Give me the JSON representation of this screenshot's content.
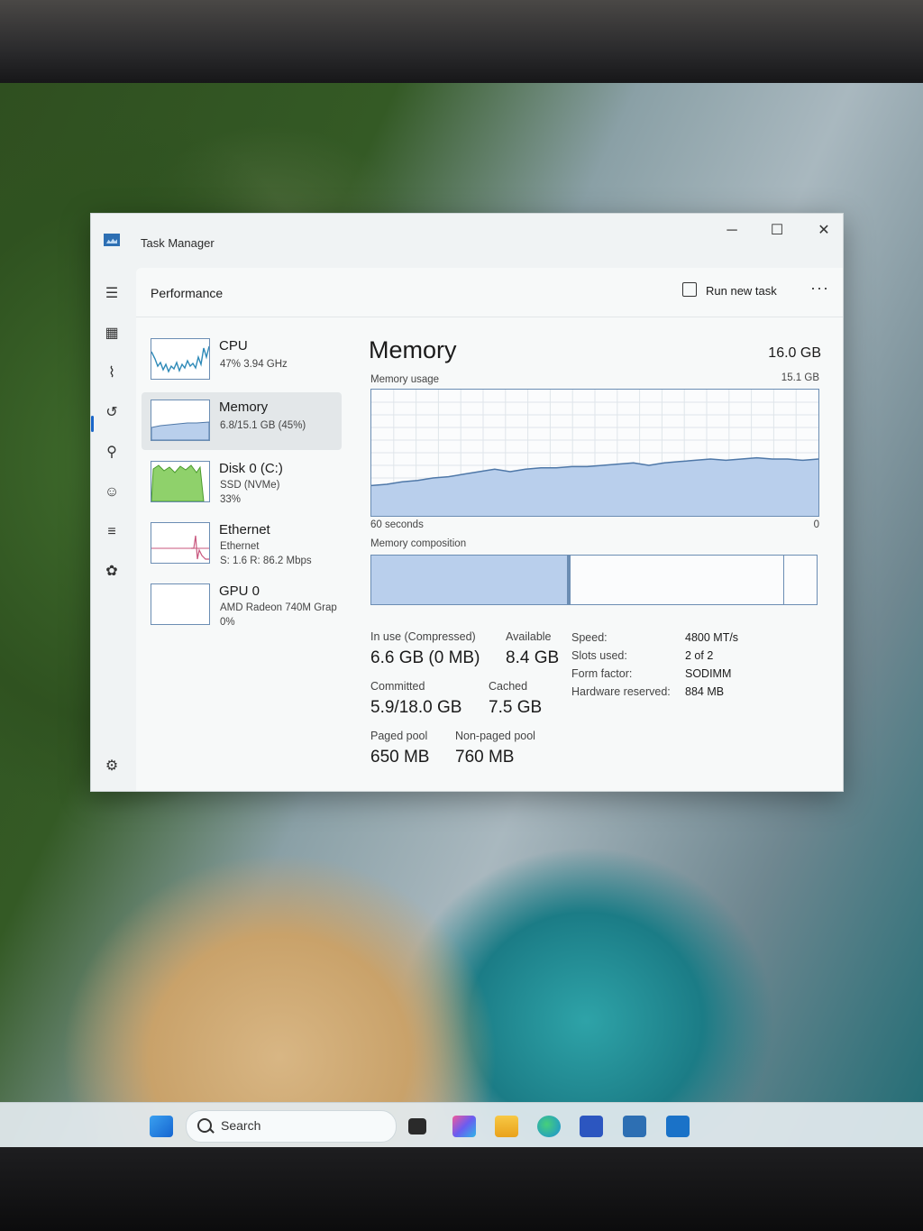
{
  "window": {
    "title": "Task Manager",
    "controls": {
      "minimize": "─",
      "maximize": "☐",
      "close": "✕"
    }
  },
  "nav": {
    "icons": [
      "hamburger-icon",
      "processes-icon",
      "performance-icon",
      "app-history-icon",
      "startup-apps-icon",
      "users-icon",
      "details-icon",
      "services-icon",
      "settings-icon"
    ],
    "active": "performance"
  },
  "header": {
    "page_title": "Performance",
    "run_new_task": "Run new task",
    "more": "···"
  },
  "devices": [
    {
      "name": "CPU",
      "sub1": "47% 3.94 GHz",
      "sub2": "",
      "sub3": ""
    },
    {
      "name": "Memory",
      "sub1": "6.8/15.1 GB (45%)",
      "sub2": "",
      "sub3": ""
    },
    {
      "name": "Disk 0 (C:)",
      "sub1": "SSD (NVMe)",
      "sub2": "33%",
      "sub3": ""
    },
    {
      "name": "Ethernet",
      "sub1": "Ethernet",
      "sub2": "S: 1.6 R: 86.2 Mbps",
      "sub3": ""
    },
    {
      "name": "GPU 0",
      "sub1": "AMD Radeon 740M Grap",
      "sub2": "0%",
      "sub3": ""
    }
  ],
  "memory": {
    "title": "Memory",
    "total": "16.0 GB",
    "usage_label": "Memory usage",
    "usage_max": "15.1 GB",
    "time_left": "60 seconds",
    "time_right": "0",
    "composition_label": "Memory composition",
    "in_use_fraction": 0.44,
    "stats": {
      "in_use_label": "In use (Compressed)",
      "in_use_value": "6.6 GB (0 MB)",
      "available_label": "Available",
      "available_value": "8.4 GB",
      "committed_label": "Committed",
      "committed_value": "5.9/18.0 GB",
      "cached_label": "Cached",
      "cached_value": "7.5 GB",
      "paged_label": "Paged pool",
      "paged_value": "650 MB",
      "nonpaged_label": "Non-paged pool",
      "nonpaged_value": "760 MB"
    },
    "specs": {
      "speed_label": "Speed:",
      "speed_value": "4800 MT/s",
      "slots_label": "Slots used:",
      "slots_value": "2 of 2",
      "form_label": "Form factor:",
      "form_value": "SODIMM",
      "hw_label": "Hardware reserved:",
      "hw_value": "884 MB"
    },
    "usage_history": [
      0.24,
      0.25,
      0.27,
      0.28,
      0.3,
      0.31,
      0.33,
      0.35,
      0.37,
      0.35,
      0.37,
      0.38,
      0.38,
      0.39,
      0.39,
      0.4,
      0.41,
      0.42,
      0.4,
      0.42,
      0.43,
      0.44,
      0.45,
      0.44,
      0.45,
      0.46,
      0.45,
      0.45,
      0.44,
      0.45
    ]
  },
  "taskbar": {
    "search_placeholder": "Search"
  },
  "colors": {
    "accent": "#1a66c9",
    "memory_fill": "#b9cfec",
    "memory_line": "#4f78a8",
    "cpu_line": "#2e8ab8",
    "disk_fill": "#8fd16b",
    "ethernet_line": "#c8577e"
  }
}
